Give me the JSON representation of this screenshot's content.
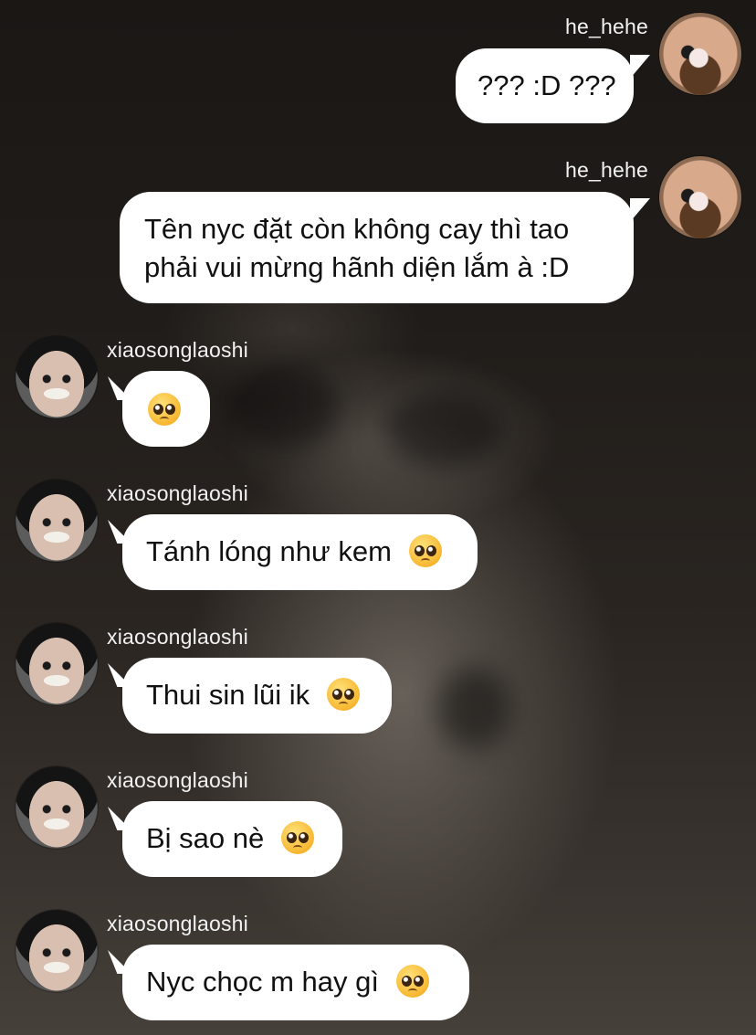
{
  "messages": [
    {
      "sender": "he_hehe",
      "side": "right",
      "lines": [
        "??? :D ???"
      ]
    },
    {
      "sender": "he_hehe",
      "side": "right",
      "lines": [
        "Tên nyc đặt còn không cay thì tao",
        "phải vui mừng hãnh diện lắm à :D"
      ]
    },
    {
      "sender": "xiaosonglaoshi",
      "side": "left",
      "text": "",
      "emoji": "pleading-face-emoji"
    },
    {
      "sender": "xiaosonglaoshi",
      "side": "left",
      "text": "Tánh lóng như kem",
      "emoji": "pleading-face-emoji"
    },
    {
      "sender": "xiaosonglaoshi",
      "side": "left",
      "text": "Thui sin lũi ik",
      "emoji": "pleading-face-emoji"
    },
    {
      "sender": "xiaosonglaoshi",
      "side": "left",
      "text": "Bị sao nè",
      "emoji": "pleading-face-emoji"
    },
    {
      "sender": "xiaosonglaoshi",
      "side": "left",
      "text": "Nyc chọc m hay gì",
      "emoji": "pleading-face-emoji"
    }
  ],
  "colors": {
    "bubble": "#ffffff",
    "text": "#111111",
    "username": "#f2f2f2",
    "background": "#1e1a17"
  }
}
